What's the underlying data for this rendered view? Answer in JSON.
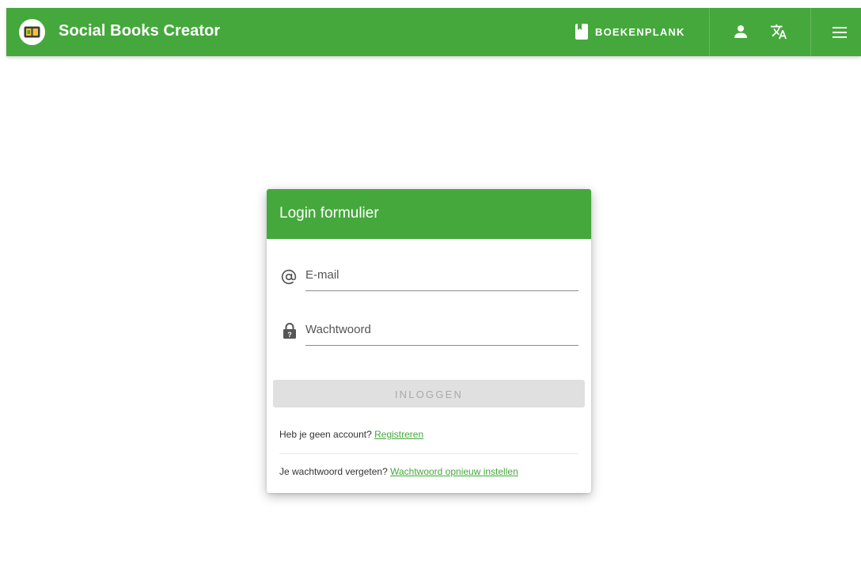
{
  "header": {
    "app_title": "Social Books Creator",
    "bookshelf_label": "BOEKENPLANK",
    "icons": [
      "book-logo-icon",
      "bookshelf-icon",
      "user-icon",
      "translate-icon",
      "menu-icon"
    ]
  },
  "login": {
    "title": "Login formulier",
    "email_placeholder": "E-mail",
    "email_value": "",
    "password_placeholder": "Wachtwoord",
    "password_value": "",
    "submit_label": "INLOGGEN",
    "no_account_text": "Heb je geen account?",
    "register_link": "Registreren",
    "forgot_text": "Je wachtwoord vergeten?",
    "reset_link": "Wachtwoord opnieuw instellen"
  },
  "colors": {
    "primary": "#45a83c",
    "button_disabled_bg": "#e0e0e0",
    "button_disabled_text": "#a9a9a9"
  }
}
